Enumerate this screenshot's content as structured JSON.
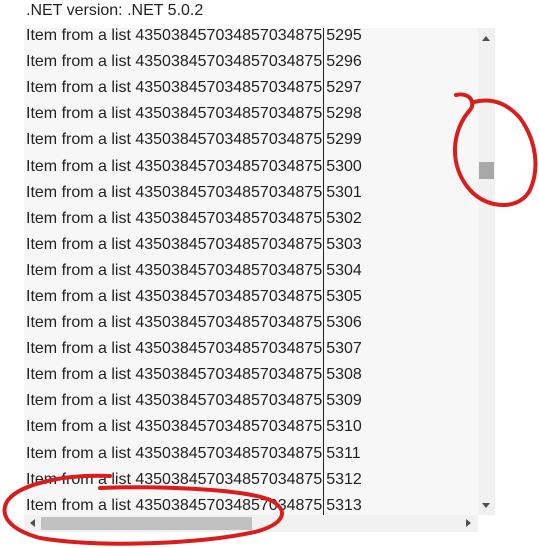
{
  "header": {
    "version_text": ".NET version: .NET 5.0.2"
  },
  "list": {
    "item_text": "Item from a list 435038457034857034875",
    "rows": [
      {
        "name": "Item from a list 435038457034857034875",
        "num": "5295"
      },
      {
        "name": "Item from a list 435038457034857034875",
        "num": "5296"
      },
      {
        "name": "Item from a list 435038457034857034875",
        "num": "5297"
      },
      {
        "name": "Item from a list 435038457034857034875",
        "num": "5298"
      },
      {
        "name": "Item from a list 435038457034857034875",
        "num": "5299"
      },
      {
        "name": "Item from a list 435038457034857034875",
        "num": "5300"
      },
      {
        "name": "Item from a list 435038457034857034875",
        "num": "5301"
      },
      {
        "name": "Item from a list 435038457034857034875",
        "num": "5302"
      },
      {
        "name": "Item from a list 435038457034857034875",
        "num": "5303"
      },
      {
        "name": "Item from a list 435038457034857034875",
        "num": "5304"
      },
      {
        "name": "Item from a list 435038457034857034875",
        "num": "5305"
      },
      {
        "name": "Item from a list 435038457034857034875",
        "num": "5306"
      },
      {
        "name": "Item from a list 435038457034857034875",
        "num": "5307"
      },
      {
        "name": "Item from a list 435038457034857034875",
        "num": "5308"
      },
      {
        "name": "Item from a list 435038457034857034875",
        "num": "5309"
      },
      {
        "name": "Item from a list 435038457034857034875",
        "num": "5310"
      },
      {
        "name": "Item from a list 435038457034857034875",
        "num": "5311"
      },
      {
        "name": "Item from a list 435038457034857034875",
        "num": "5312"
      },
      {
        "name": "Item from a list 435038457034857034875",
        "num": "5313"
      }
    ]
  },
  "colors": {
    "annotation": "#d91c1c",
    "list_bg": "#f7f7f7",
    "scroll_thumb": "#a8a8a8"
  }
}
